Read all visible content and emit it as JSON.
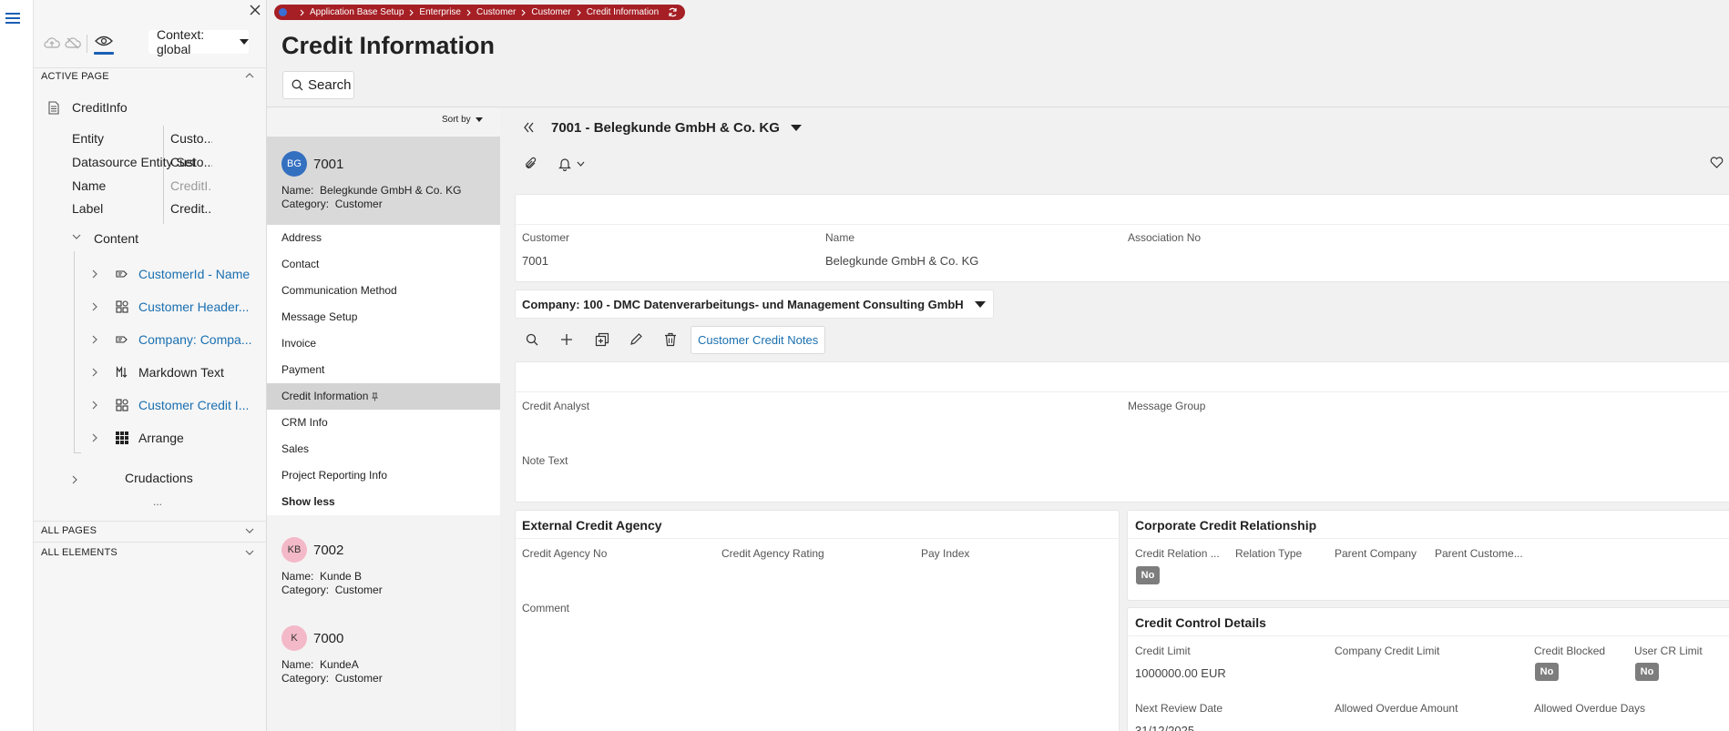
{
  "breadcrumb": {
    "items": [
      "Application Base Setup",
      "Enterprise",
      "Customer",
      "Customer",
      "Credit Information"
    ]
  },
  "page": {
    "title": "Credit Information",
    "search_label": "Search"
  },
  "inspector": {
    "context_label": "Context: global",
    "active_page_label": "ACTIVE PAGE",
    "page_name": "CreditInfo",
    "props": [
      {
        "key": "Entity",
        "value": "Custo..."
      },
      {
        "key": "Datasource Entity Set",
        "value": "Custo..."
      },
      {
        "key": "Name",
        "value": "CreditI..."
      },
      {
        "key": "Label",
        "value": "Credit..."
      }
    ],
    "content_label": "Content",
    "tree": [
      {
        "label": "CustomerId - Name",
        "icon": "field-group-icon",
        "link": true
      },
      {
        "label": "Customer Header...",
        "icon": "group-icon",
        "link": true
      },
      {
        "label": "Company: Compa...",
        "icon": "field-group-icon",
        "link": true
      },
      {
        "label": "Markdown Text",
        "icon": "markdown-icon",
        "link": false
      },
      {
        "label": "Customer Credit I...",
        "icon": "group-icon",
        "link": true
      },
      {
        "label": "Arrange",
        "icon": "grid-icon",
        "link": false
      }
    ],
    "crudactions_label": "Crudactions",
    "more": "...",
    "all_pages_label": "ALL PAGES",
    "all_elements_label": "ALL ELEMENTS"
  },
  "list": {
    "sort_label": "Sort by",
    "name_prefix": "Name:",
    "category_prefix": "Category:",
    "selected": {
      "initials": "BG",
      "id": "7001",
      "name": "Belegkunde GmbH & Co. KG",
      "category": "Customer"
    },
    "nav_items": [
      "Address",
      "Contact",
      "Communication Method",
      "Message Setup",
      "Invoice",
      "Payment",
      "Credit Information",
      "CRM Info",
      "Sales",
      "Project Reporting Info"
    ],
    "active_nav_index": 6,
    "show_less": "Show less",
    "records": [
      {
        "initials": "KB",
        "id": "7002",
        "name": "Kunde B",
        "category": "Customer"
      },
      {
        "initials": "K",
        "id": "7000",
        "name": "KundeA",
        "category": "Customer"
      }
    ]
  },
  "record": {
    "title": "7001 - Belegkunde GmbH & Co. KG",
    "header_fields": [
      {
        "label": "Customer",
        "value": "7001"
      },
      {
        "label": "Name",
        "value": "Belegkunde GmbH & Co. KG"
      },
      {
        "label": "Association No",
        "value": ""
      }
    ],
    "company_selector": "Company: 100 - DMC Datenverarbeitungs- und Management Consulting GmbH",
    "notes_button": "Customer Credit Notes",
    "credit_fields": {
      "analyst_label": "Credit Analyst",
      "message_group_label": "Message Group",
      "note_text_label": "Note Text"
    },
    "external_agency": {
      "title": "External Credit Agency",
      "labels": [
        "Credit Agency No",
        "Credit Agency Rating",
        "Pay Index"
      ],
      "comment_label": "Comment"
    },
    "corporate": {
      "title": "Corporate Credit Relationship",
      "labels": [
        "Credit Relation ...",
        "Relation Type",
        "Parent Company",
        "Parent Custome..."
      ],
      "relation_value": "No"
    },
    "control": {
      "title": "Credit Control Details",
      "credit_limit_label": "Credit Limit",
      "credit_limit_value": "1000000.00 EUR",
      "company_limit_label": "Company Credit Limit",
      "blocked_label": "Credit Blocked",
      "blocked_value": "No",
      "user_cr_label": "User CR Limit",
      "user_cr_value": "No",
      "next_review_label": "Next Review Date",
      "next_review_value": "31/12/2025",
      "overdue_amount_label": "Allowed Overdue Amount",
      "overdue_days_label": "Allowed Overdue Days"
    }
  },
  "colors": {
    "breadcrumb_bg": "#a51f25",
    "link": "#1a6fb0",
    "accent": "#1a5fb4"
  }
}
